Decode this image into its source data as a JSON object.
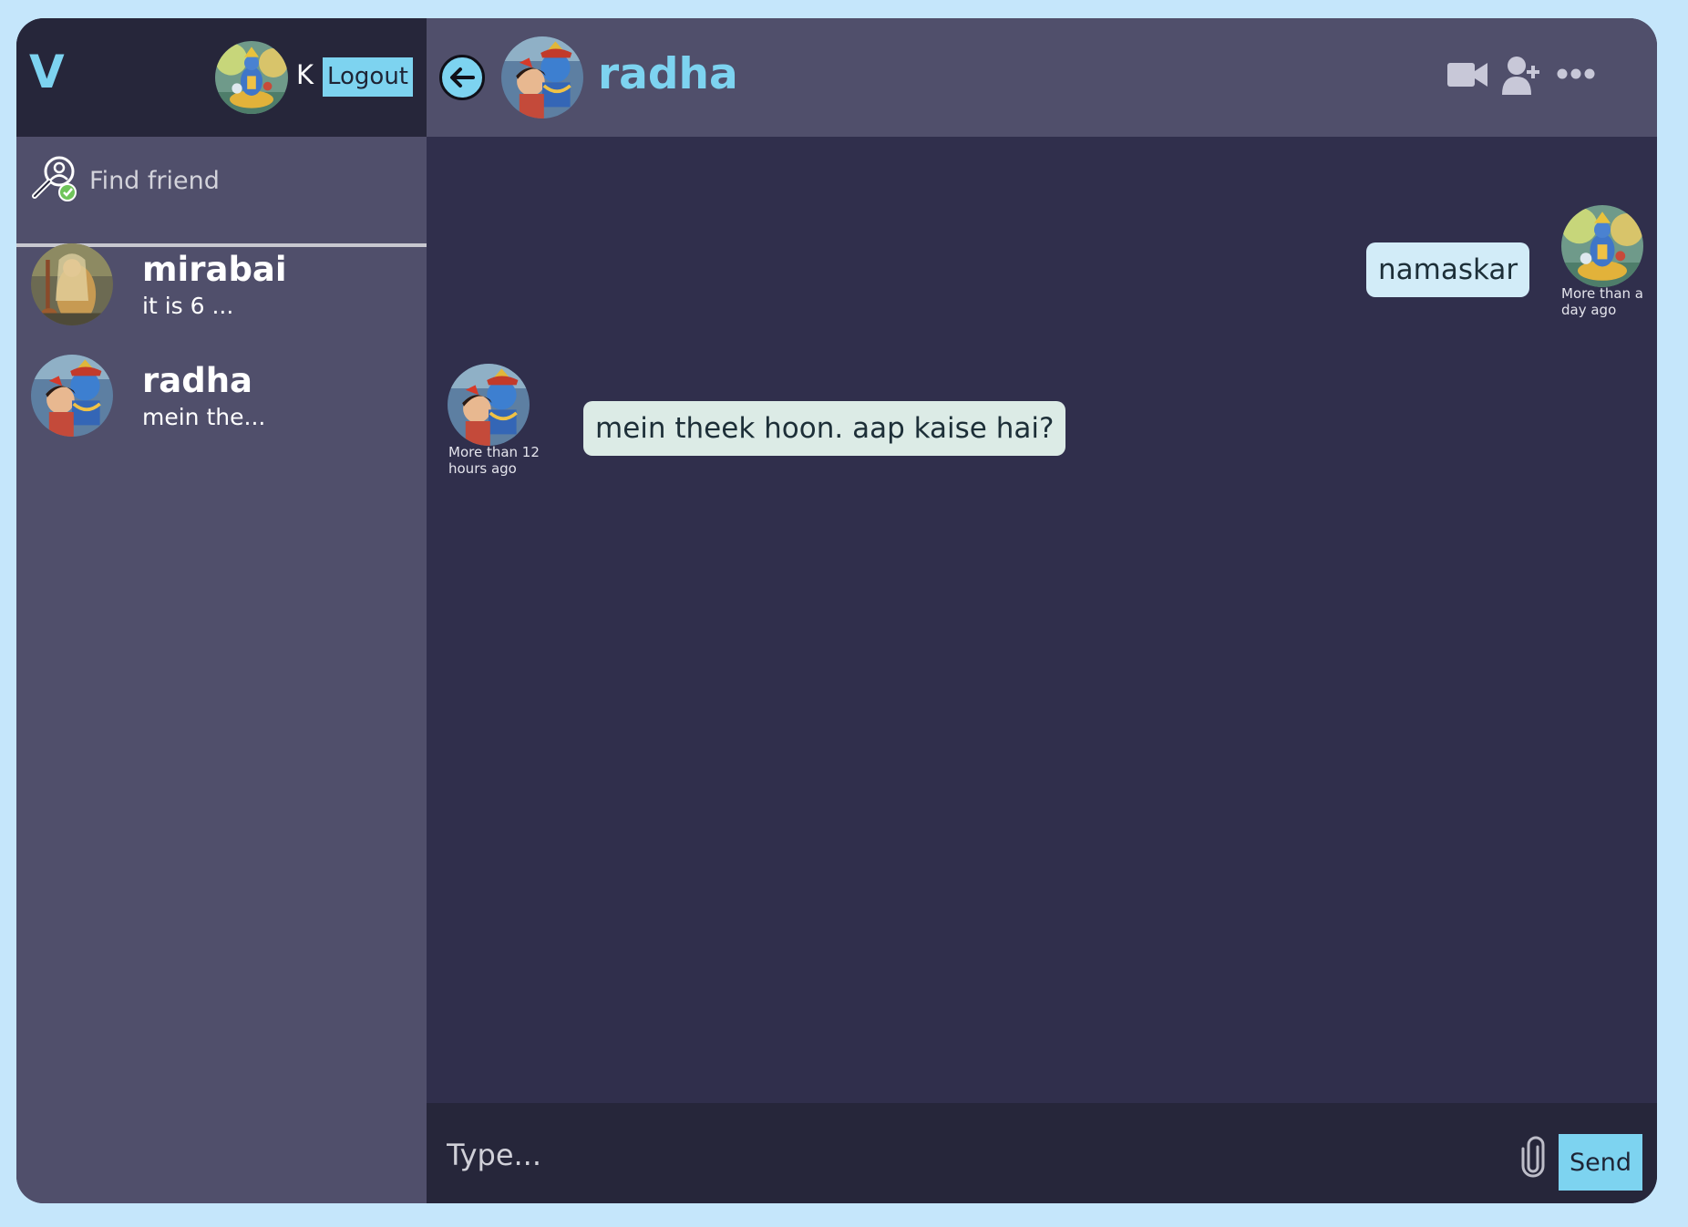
{
  "sidebar": {
    "brand": "V",
    "user": {
      "name": "K",
      "avatar": "krishna-seated-avatar"
    },
    "logout_label": "Logout",
    "search": {
      "placeholder": "Find friend",
      "icon": "user-search-icon"
    },
    "chats": [
      {
        "name": "mirabai",
        "last_message": "it is 6 ...",
        "avatar": "mirabai-avatar"
      },
      {
        "name": "radha",
        "last_message": "mein the...",
        "avatar": "radha-krishna-avatar"
      }
    ]
  },
  "chat": {
    "contact_name": "radha",
    "icons": [
      "back-arrow-icon",
      "video-camera-icon",
      "add-user-icon",
      "more-options-icon"
    ],
    "messages": [
      {
        "text": "namaskar",
        "time": "More than a day ago",
        "own": true
      },
      {
        "text": "mein theek hoon. aap kaise hai?",
        "time": "More than 12 hours ago",
        "own": false
      }
    ]
  },
  "input": {
    "placeholder": "Type...",
    "attach_icon": "paperclip-icon",
    "send_label": "Send"
  },
  "colors": {
    "background": "#c5e6fb",
    "accent": "#7dd3f0",
    "sidebar": "#504f6b",
    "header_dark": "#26263a",
    "messages_bg": "#302f4c",
    "own_bubble": "#d2ecf8",
    "other_bubble": "#dcebe6"
  }
}
